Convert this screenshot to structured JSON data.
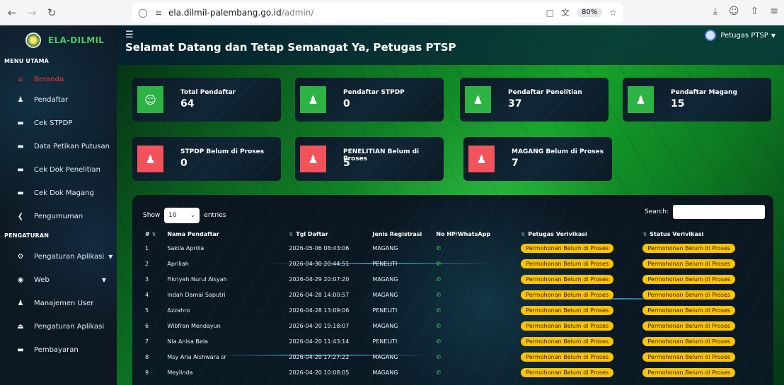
{
  "browser": {
    "url_host": "ela.dilmil-palembang.go.id",
    "url_path": "/admin/",
    "zoom": "80%"
  },
  "sidebar": {
    "brand": "ELA-DILMIL",
    "section_main": "MENU UTAMA",
    "items": [
      {
        "label": "Beranda",
        "icon": "home-icon"
      },
      {
        "label": "Pendaftar",
        "icon": "users-icon"
      },
      {
        "label": "Cek STPDP",
        "icon": "id-card-icon"
      },
      {
        "label": "Data Petikan Putusan",
        "icon": "id-card-icon"
      },
      {
        "label": "Cek Dok Penelitian",
        "icon": "id-card-icon"
      },
      {
        "label": "Cek Dok Magang",
        "icon": "id-card-icon"
      },
      {
        "label": "Pengumuman",
        "icon": "megaphone-icon"
      }
    ],
    "section_settings": "PENGATURAN",
    "settings": [
      {
        "label": "Pengaturan Aplikasi",
        "icon": "gear-icon"
      },
      {
        "label": "Web",
        "icon": "globe-icon"
      },
      {
        "label": "Manajemen User",
        "icon": "users-icon"
      },
      {
        "label": "Pengaturan Aplikasi",
        "icon": "eject-icon"
      },
      {
        "label": "Pembayaran",
        "icon": "id-card-icon"
      }
    ]
  },
  "header": {
    "welcome": "Selamat Datang dan Tetap Semangat Ya, Petugas PTSP",
    "user": "Petugas PTSP"
  },
  "cards": [
    {
      "label": "Total Pendaftar",
      "value": "64"
    },
    {
      "label": "Pendaftar STPDP",
      "value": "0"
    },
    {
      "label": "Pendaftar Penelitian",
      "value": "37"
    },
    {
      "label": "Pendaftar Magang",
      "value": "15"
    },
    {
      "label": "STPDP Belum di Proses",
      "value": "0"
    },
    {
      "label": "PENELITIAN Belum di Proses",
      "value": "5"
    },
    {
      "label": "MAGANG Belum di Proses",
      "value": "7"
    }
  ],
  "table": {
    "show": "Show",
    "entries_value": "10",
    "entries": "entries",
    "search": "Search:",
    "headers": [
      "#",
      "Nama Pendaftar",
      "Tgl Daftar",
      "Jenis Registrasi",
      "No HP/WhatsApp",
      "Petugas Verivikasi",
      "Status Verivikasi"
    ],
    "rows": [
      {
        "no": "1",
        "name": "Sakila Aprilia",
        "date": "2026-05-06 08:43:06",
        "type": "MAGANG",
        "phone": "",
        "officer": "Permohonan Belum di Proses",
        "status": "Permohonan Belum di Proses"
      },
      {
        "no": "2",
        "name": "Apriliah",
        "date": "2026-04-30 20:44:51",
        "type": "PENELITI",
        "phone": "",
        "officer": "Permohonan Belum di Proses",
        "status": "Permohonan Belum di Proses"
      },
      {
        "no": "3",
        "name": "Fikriyah Nurul Aisyah",
        "date": "2026-04-29 20:07:20",
        "type": "MAGANG",
        "phone": "",
        "officer": "Permohonan Belum di Proses",
        "status": "Permohonan Belum di Proses"
      },
      {
        "no": "4",
        "name": "Indah Damai Saputri",
        "date": "2026-04-28 14:00:57",
        "type": "MAGANG",
        "phone": "",
        "officer": "Permohonan Belum di Proses",
        "status": "Permohonan Belum di Proses"
      },
      {
        "no": "5",
        "name": "Azzahro",
        "date": "2026-04-28 13:09:06",
        "type": "PENELITI",
        "phone": "",
        "officer": "Permohonan Belum di Proses",
        "status": "Permohonan Belum di Proses"
      },
      {
        "no": "6",
        "name": "Wibfran Mendayun",
        "date": "2026-04-20 19:18:07",
        "type": "MAGANG",
        "phone": "",
        "officer": "Permohonan Belum di Proses",
        "status": "Permohonan Belum di Proses"
      },
      {
        "no": "7",
        "name": "Nia Anisa Bela",
        "date": "2026-04-20 11:43:14",
        "type": "PENELITI",
        "phone": "",
        "officer": "Permohonan Belum di Proses",
        "status": "Permohonan Belum di Proses"
      },
      {
        "no": "8",
        "name": "Msy Aria Aishwara sr",
        "date": "2026-04-20 17:27:22",
        "type": "MAGANG",
        "phone": "",
        "officer": "Permohonan Belum di Proses",
        "status": "Permohonan Belum di Proses"
      },
      {
        "no": "9",
        "name": "Meylinda",
        "date": "2026-04-20 10:08:05",
        "type": "MAGANG",
        "phone": "",
        "officer": "Permohonan Belum di Proses",
        "status": "Permohonan Belum di Proses"
      }
    ]
  }
}
